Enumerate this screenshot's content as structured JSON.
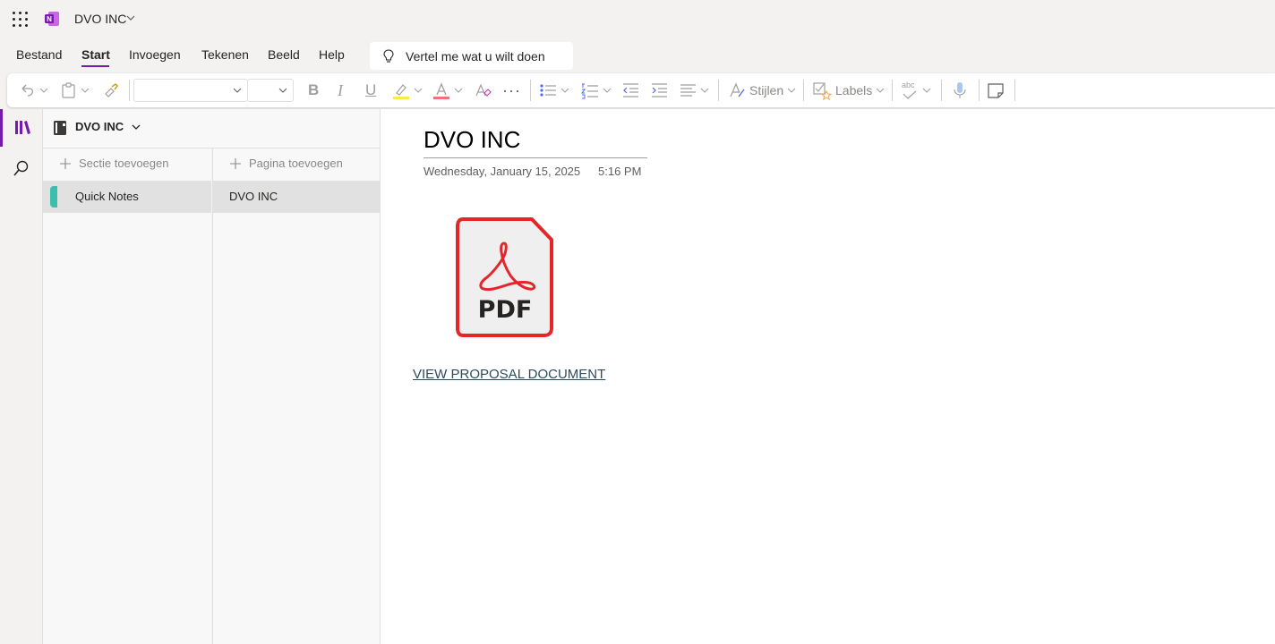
{
  "titlebar": {
    "notebook_name": "DVO INC"
  },
  "tabs": [
    {
      "label": "Bestand"
    },
    {
      "label": "Start",
      "active": true
    },
    {
      "label": "Invoegen"
    },
    {
      "label": "Tekenen"
    },
    {
      "label": "Beeld"
    },
    {
      "label": "Help"
    }
  ],
  "tellme": {
    "placeholder": "Vertel me wat u wilt doen"
  },
  "ribbon": {
    "styles_label": "Stijlen",
    "labels_label": "Labels",
    "spelling_icon_text": "abc",
    "bold": "B",
    "italic": "I",
    "underline": "U",
    "font_name": "",
    "font_size": ""
  },
  "navigation": {
    "notebook_name": "DVO INC",
    "add_section": "Sectie toevoegen",
    "add_page": "Pagina toevoegen",
    "sections": [
      {
        "label": "Quick Notes",
        "color": "#3bbfad"
      }
    ],
    "pages": [
      {
        "label": "DVO INC"
      }
    ]
  },
  "page": {
    "title": "DVO INC",
    "date": "Wednesday, January 15, 2025",
    "time": "5:16 PM",
    "attachment_text": "PDF",
    "link_text": "VIEW PROPOSAL DOCUMENT"
  },
  "colors": {
    "accent": "#7719aa",
    "section": "#3bbfad",
    "pdf_red": "#e5252a",
    "link": "#2b4c5e"
  }
}
